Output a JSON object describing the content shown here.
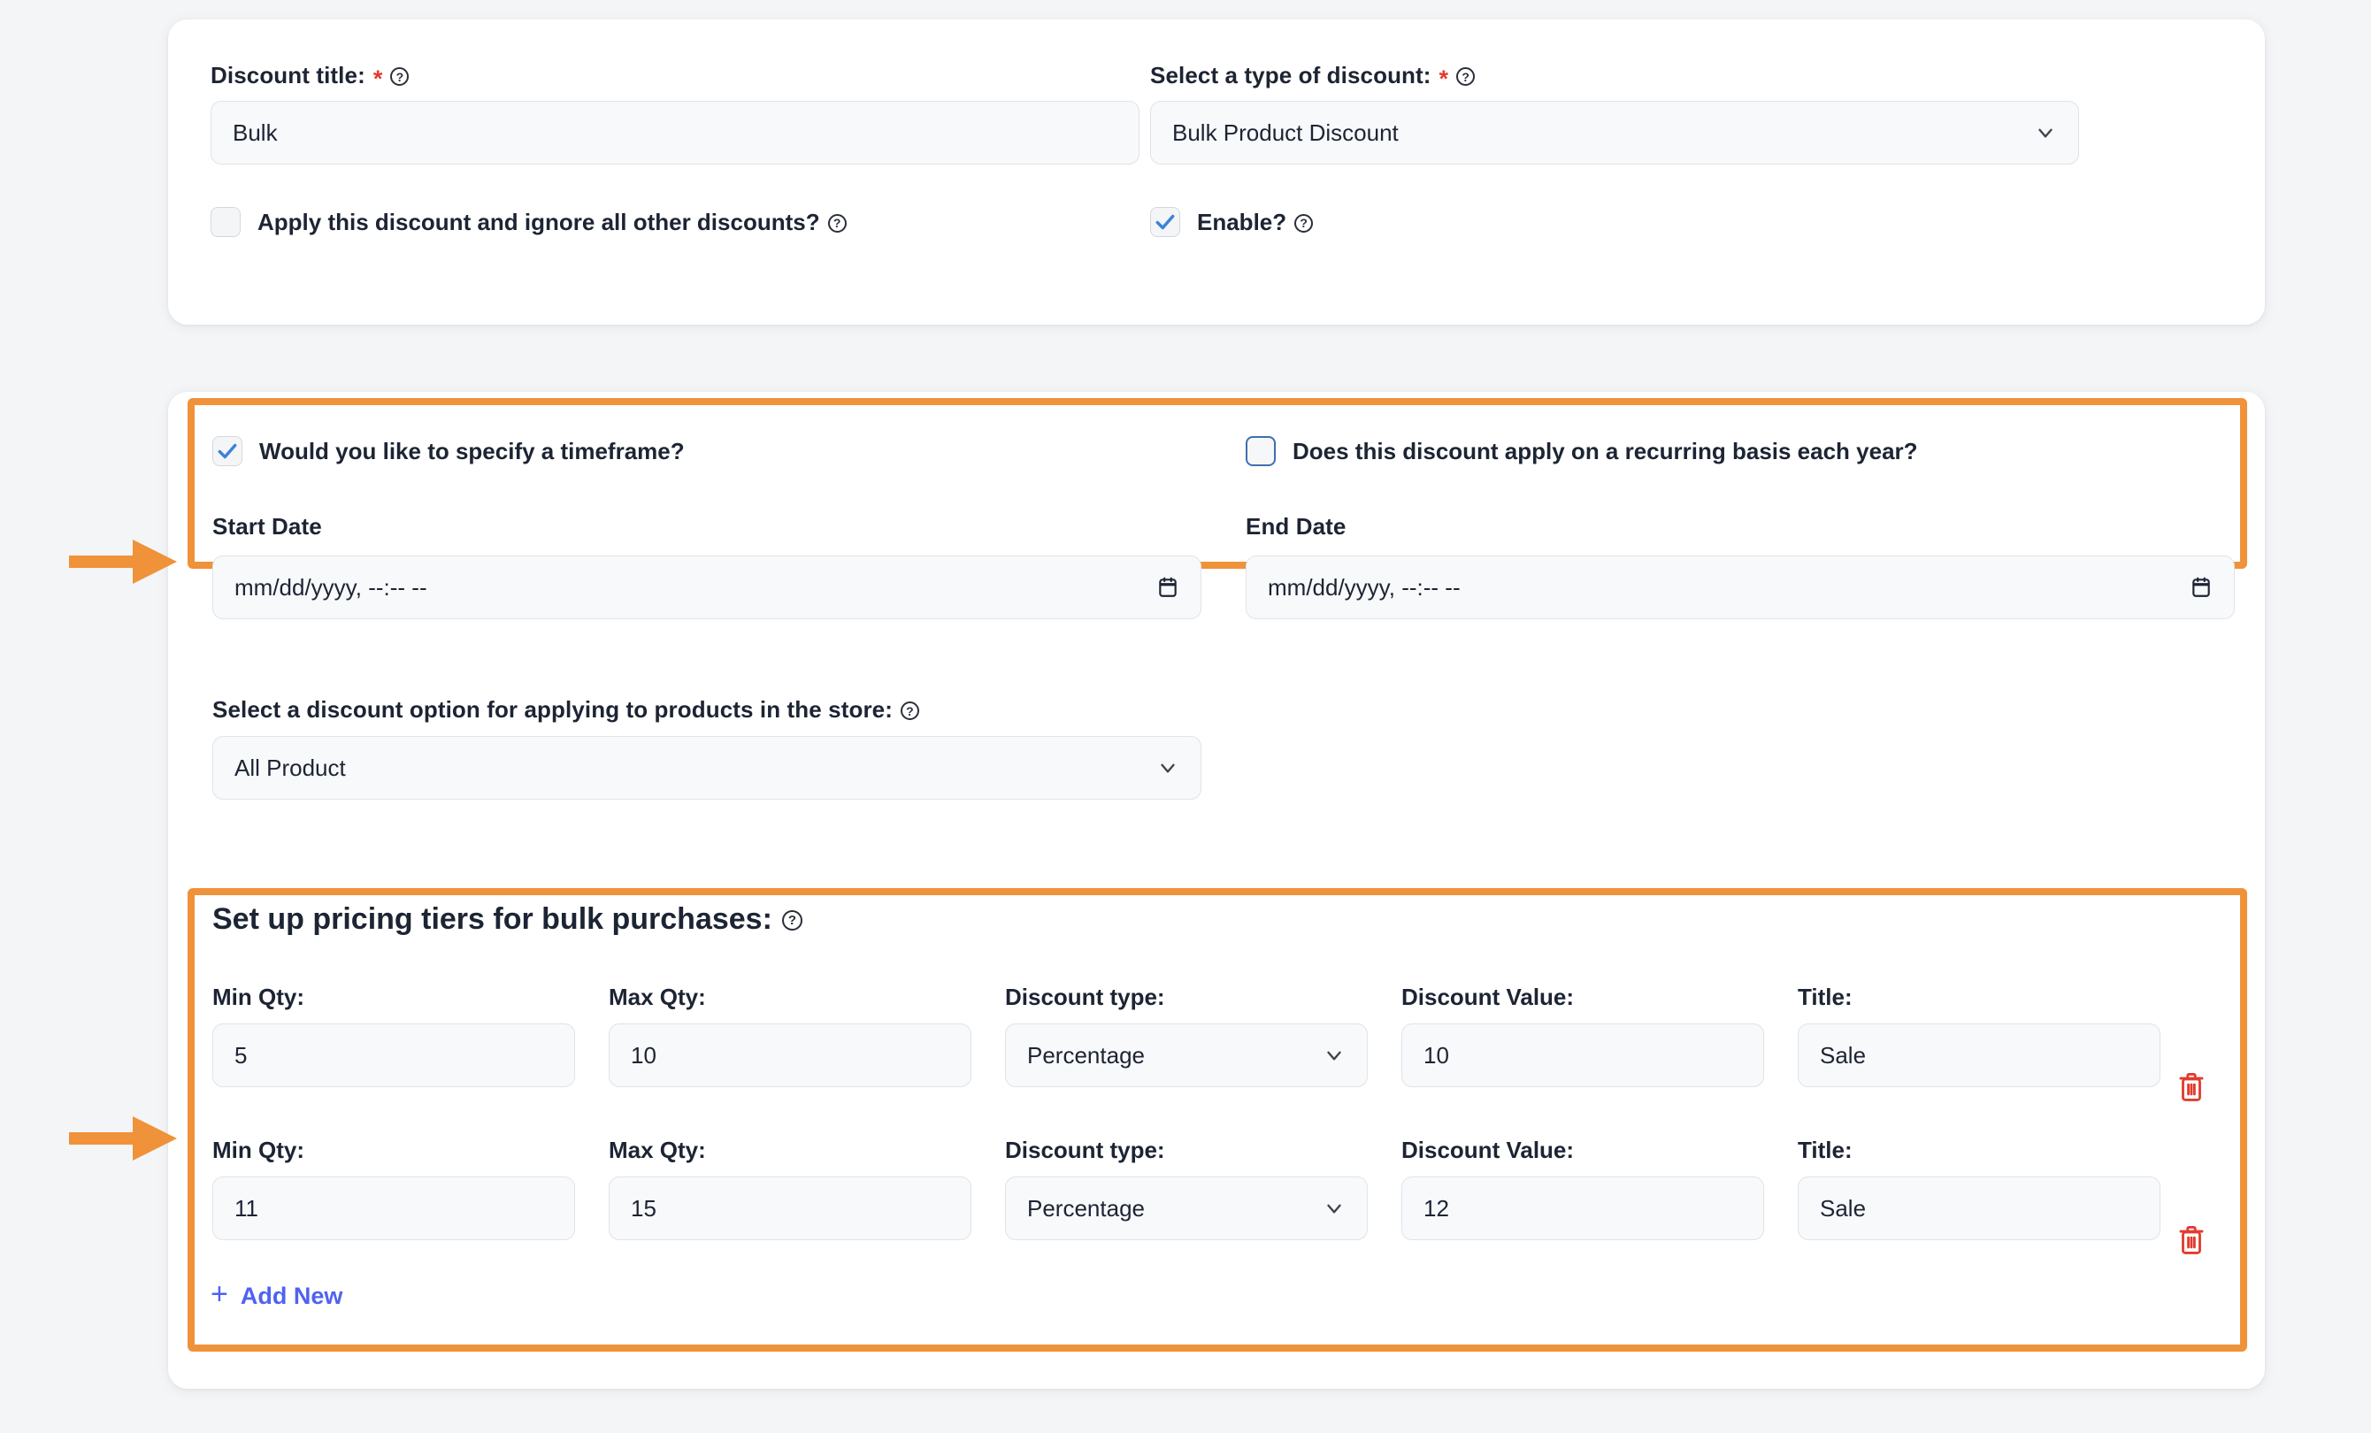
{
  "general": {
    "discount_title": {
      "label": "Discount title:",
      "required_mark": "*",
      "help_icon": "help-circle-icon",
      "value": "Bulk"
    },
    "discount_type": {
      "label": "Select a type of discount:",
      "required_mark": "*",
      "help_icon": "help-circle-icon",
      "value": "Bulk Product Discount",
      "chevron_icon": "chevron-down-icon"
    },
    "ignore_other": {
      "label": "Apply this discount and ignore all other discounts?",
      "help_icon": "help-circle-icon",
      "checked": false
    },
    "enable": {
      "label": "Enable?",
      "help_icon": "help-circle-icon",
      "checked": true
    }
  },
  "timeframe": {
    "specify": {
      "label": "Would you like to specify a timeframe?",
      "checked": true
    },
    "recurring": {
      "label": "Does this discount apply on a recurring basis each year?",
      "checked": false
    },
    "start_date": {
      "label": "Start Date",
      "placeholder": "mm/dd/yyyy, --:-- --",
      "value": "",
      "calendar_icon": "calendar-icon"
    },
    "end_date": {
      "label": "End Date",
      "placeholder": "mm/dd/yyyy, --:-- --",
      "value": "",
      "calendar_icon": "calendar-icon"
    }
  },
  "product_option": {
    "label": "Select a discount option for applying to products in the store:",
    "help_icon": "help-circle-icon",
    "value": "All Product",
    "chevron_icon": "chevron-down-icon"
  },
  "tiers": {
    "title": "Set up pricing tiers for bulk purchases:",
    "help_icon": "help-circle-icon",
    "headers": {
      "min_qty": "Min Qty:",
      "max_qty": "Max Qty:",
      "discount_type": "Discount type:",
      "discount_value": "Discount Value:",
      "title": "Title:"
    },
    "rows": [
      {
        "min_qty": "5",
        "max_qty": "10",
        "discount_type": "Percentage",
        "discount_value": "10",
        "title": "Sale",
        "delete_icon": "trash-icon"
      },
      {
        "min_qty": "11",
        "max_qty": "15",
        "discount_type": "Percentage",
        "discount_value": "12",
        "title": "Sale",
        "delete_icon": "trash-icon"
      }
    ],
    "add_new": {
      "label": "Add New",
      "icon": "plus-icon"
    }
  },
  "annotations": {
    "highlight_color": "#ef9239",
    "arrows": [
      {
        "name": "arrow-start-date"
      },
      {
        "name": "arrow-tier-row"
      }
    ]
  },
  "colors": {
    "accent_link": "#4f62f0",
    "danger": "#e23b2e",
    "highlight": "#ef9239",
    "checkbox_check": "#3b82d6"
  }
}
